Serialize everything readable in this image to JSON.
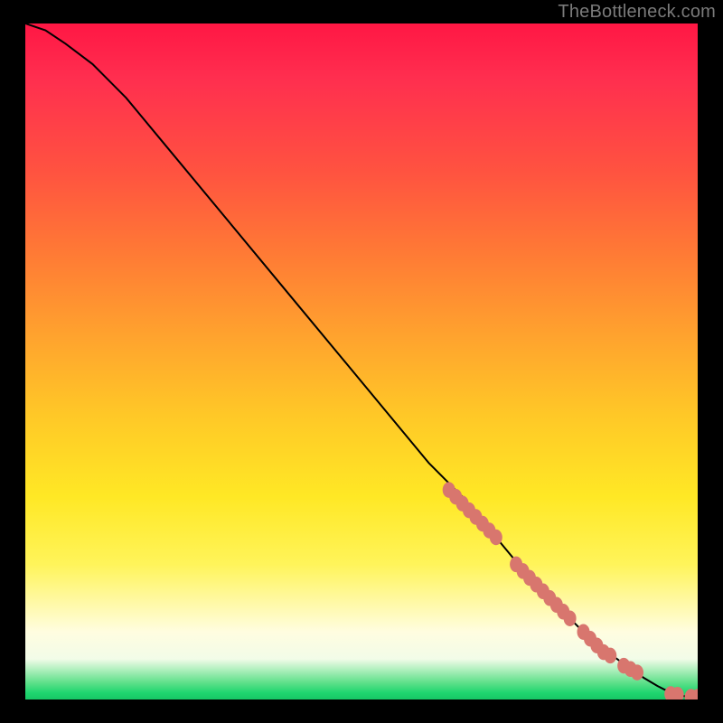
{
  "attribution": "TheBottleneck.com",
  "chart_data": {
    "type": "line",
    "title": "",
    "xlabel": "",
    "ylabel": "",
    "xlim": [
      0,
      100
    ],
    "ylim": [
      0,
      100
    ],
    "grid": false,
    "legend": false,
    "series": [
      {
        "name": "curve",
        "x": [
          0,
          3,
          6,
          10,
          15,
          20,
          30,
          40,
          50,
          60,
          65,
          70,
          75,
          80,
          85,
          88,
          90,
          92,
          94,
          95,
          96,
          97,
          98,
          99,
          100
        ],
        "values": [
          100,
          99,
          97,
          94,
          89,
          83,
          71,
          59,
          47,
          35,
          30,
          24,
          18,
          13,
          8,
          6,
          4.5,
          3.2,
          2.0,
          1.5,
          1.1,
          0.8,
          0.5,
          0.4,
          0.4
        ]
      },
      {
        "name": "markers",
        "x": [
          63,
          64,
          65,
          66,
          67,
          68,
          69,
          70,
          73,
          74,
          75,
          76,
          77,
          78,
          79,
          80,
          81,
          83,
          84,
          85,
          86,
          87,
          89,
          90,
          91,
          96,
          97,
          99,
          100
        ],
        "values": [
          31,
          30,
          29,
          28,
          27,
          26,
          25,
          24,
          20,
          19,
          18,
          17,
          16,
          15,
          14,
          13,
          12,
          10,
          9,
          8,
          7,
          6.5,
          5,
          4.5,
          4,
          0.8,
          0.7,
          0.4,
          0.4
        ]
      }
    ]
  }
}
